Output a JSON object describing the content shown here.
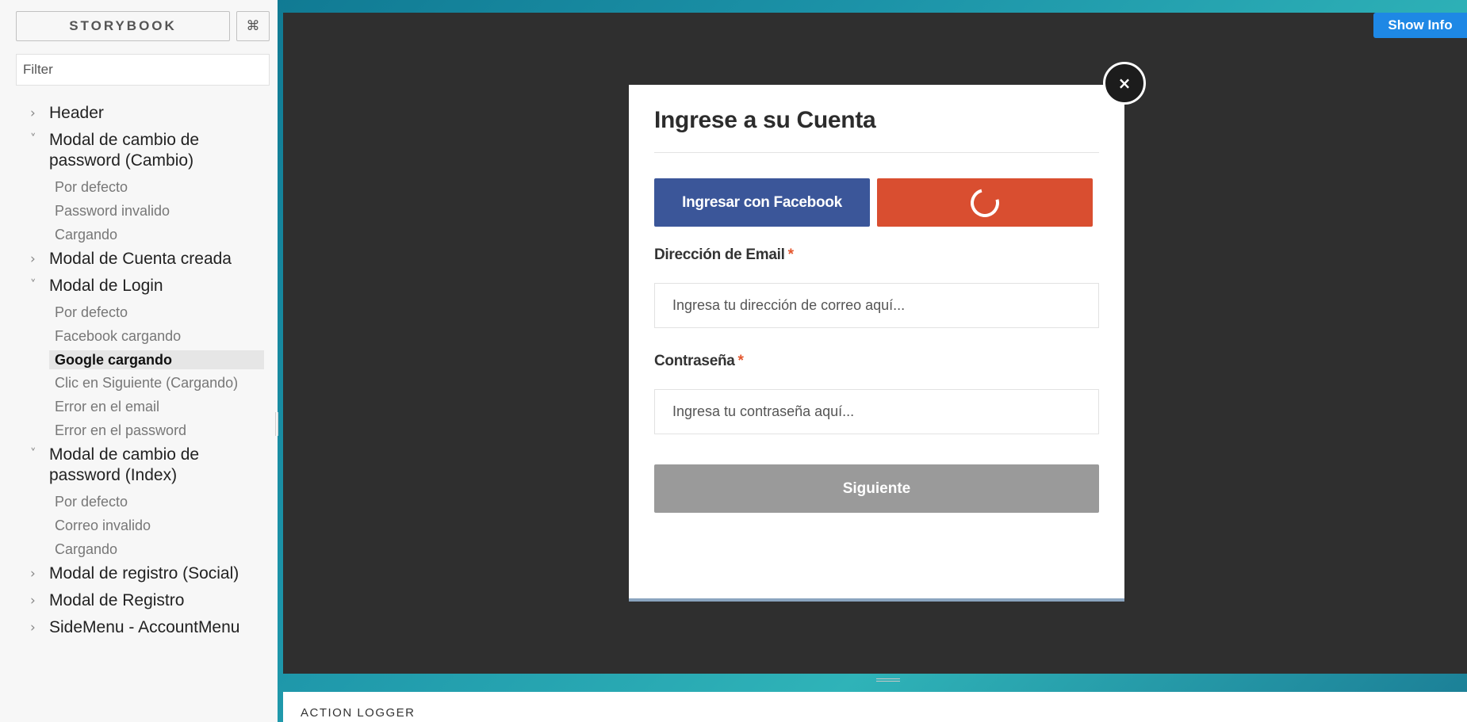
{
  "sidebar": {
    "brand": "STORYBOOK",
    "shortcut_icon": "⌘",
    "filter_placeholder": "Filter",
    "tree": [
      {
        "label": "Header",
        "expanded": false,
        "stories": []
      },
      {
        "label": "Modal de cambio de password (Cambio)",
        "expanded": true,
        "stories": [
          "Por defecto",
          "Password invalido",
          "Cargando"
        ]
      },
      {
        "label": "Modal de Cuenta creada",
        "expanded": false,
        "stories": []
      },
      {
        "label": "Modal de Login",
        "expanded": true,
        "stories": [
          "Por defecto",
          "Facebook cargando",
          "Google cargando",
          "Clic en Siguiente (Cargando)",
          "Error en el email",
          "Error en el password"
        ]
      },
      {
        "label": "Modal de cambio de password (Index)",
        "expanded": true,
        "stories": [
          "Por defecto",
          "Correo invalido",
          "Cargando"
        ]
      },
      {
        "label": "Modal de registro (Social)",
        "expanded": false,
        "stories": []
      },
      {
        "label": "Modal de Registro",
        "expanded": false,
        "stories": []
      },
      {
        "label": "SideMenu - AccountMenu",
        "expanded": false,
        "stories": []
      }
    ],
    "active_story": "Google cargando"
  },
  "preview": {
    "show_info_label": "Show Info",
    "modal": {
      "close_glyph": "×",
      "title": "Ingrese a su Cuenta",
      "facebook_button": "Ingresar con Facebook",
      "google_button_state": "loading",
      "email_label": "Dirección de Email",
      "email_placeholder": "Ingresa tu dirección de correo aquí...",
      "password_label": "Contraseña",
      "password_placeholder": "Ingresa tu contraseña aquí...",
      "required_mark": "*",
      "next_button": "Siguiente"
    }
  },
  "addons": {
    "panel_title": "ACTION LOGGER"
  },
  "colors": {
    "facebook": "#3b5699",
    "google": "#d94e30",
    "show_info": "#1e88e5",
    "required": "#e4572e"
  }
}
